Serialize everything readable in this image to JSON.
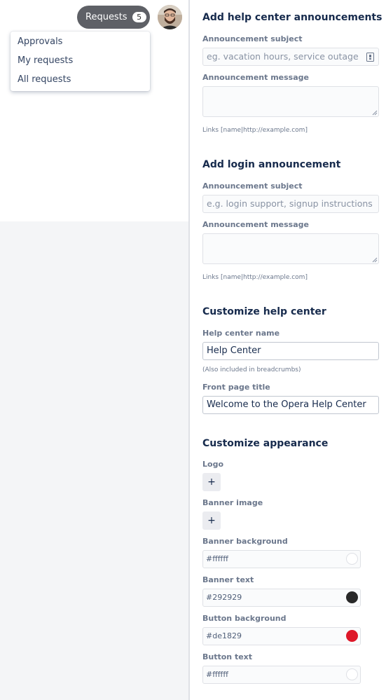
{
  "header": {
    "requests_label": "Requests",
    "requests_count": "5"
  },
  "requests_menu": {
    "items": [
      {
        "label": "Approvals"
      },
      {
        "label": "My requests"
      },
      {
        "label": "All requests"
      }
    ]
  },
  "help_center_announcements": {
    "heading": "Add help center announcements",
    "subject_label": "Announcement subject",
    "subject_placeholder": "eg. vacation hours, service outage",
    "message_label": "Announcement message",
    "links_hint": "Links [name|http://example.com]"
  },
  "login_announcement": {
    "heading": "Add login announcement",
    "subject_label": "Announcement subject",
    "subject_placeholder": "e.g. login support, signup instructions",
    "message_label": "Announcement message",
    "links_hint": "Links [name|http://example.com]"
  },
  "customize_help_center": {
    "heading": "Customize help center",
    "name_label": "Help center name",
    "name_value": "Help Center",
    "name_hint": "(Also included in breadcrumbs)",
    "title_label": "Front page title",
    "title_value": "Welcome to the Opera Help Center"
  },
  "customize_appearance": {
    "heading": "Customize appearance",
    "logo_label": "Logo",
    "banner_image_label": "Banner image",
    "add_symbol": "+",
    "colors": [
      {
        "label": "Banner background",
        "value": "#ffffff",
        "swatch": "#ffffff"
      },
      {
        "label": "Banner text",
        "value": "#292929",
        "swatch": "#292929"
      },
      {
        "label": "Button background",
        "value": "#de1829",
        "swatch": "#de1829"
      },
      {
        "label": "Button text",
        "value": "#ffffff",
        "swatch": "#ffffff"
      }
    ]
  }
}
